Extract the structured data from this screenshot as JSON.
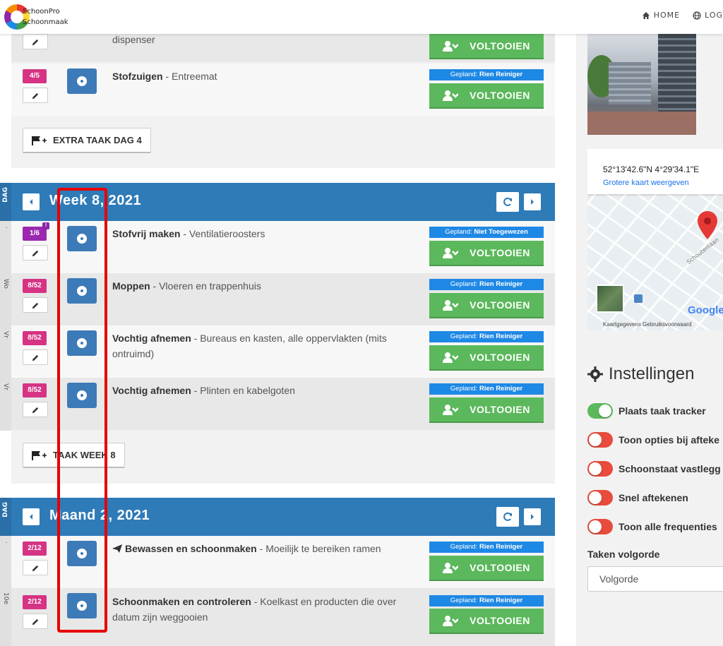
{
  "brand": {
    "line1": "SchoonPro",
    "line2": "Schoonmaak"
  },
  "nav": {
    "home": "HOME",
    "login": "LOG"
  },
  "colors": {
    "primary": "#2e7bb8",
    "success": "#5cb85c",
    "badge_pink": "#d63384",
    "badge_purple": "#9c27b0",
    "planned_blue": "#1e88e5",
    "toggle_off": "#e74c3c",
    "highlight": "#e60000"
  },
  "day4": {
    "rows": [
      {
        "task": "",
        "detail": "dispenser",
        "done": "VOLTOOIEN"
      },
      {
        "badge": "4/5",
        "task": "Stofzuigen",
        "detail": " - Entreemat",
        "planned_prefix": "Gepland: ",
        "planned_name": "Rien Reiniger",
        "done": "VOLTOOIEN"
      }
    ],
    "extra_button": "EXTRA TAAK DAG 4"
  },
  "week": {
    "side_label": "DAG",
    "title": "Week 8, 2021",
    "rows": [
      {
        "day": "·",
        "badge": "1/6",
        "badge_alert": "!",
        "task": "Stofvrij maken",
        "detail": " - Ventilatieroosters",
        "planned_prefix": "Gepland: ",
        "planned_name": "Niet Toegewezen",
        "done": "VOLTOOIEN"
      },
      {
        "day": "Wo",
        "badge": "8/52",
        "task": "Moppen",
        "detail": " - Vloeren en trappenhuis",
        "planned_prefix": "Gepland: ",
        "planned_name": "Rien Reiniger",
        "done": "VOLTOOIEN"
      },
      {
        "day": "Vr",
        "badge": "8/52",
        "task": "Vochtig afnemen",
        "detail": " - Bureaus en kasten, alle oppervlakten (mits ontruimd)",
        "planned_prefix": "Gepland: ",
        "planned_name": "Rien Reiniger",
        "done": "VOLTOOIEN"
      },
      {
        "day": "Vr",
        "badge": "8/52",
        "task": "Vochtig afnemen",
        "detail": " - Plinten en kabelgoten",
        "planned_prefix": "Gepland: ",
        "planned_name": "Rien Reiniger",
        "done": "VOLTOOIEN"
      }
    ],
    "extra_button": "TAAK WEEK 8"
  },
  "month": {
    "side_label": "DAG",
    "title": "Maand 2, 2021",
    "rows": [
      {
        "day": "·",
        "badge": "2/12",
        "task": "Bewassen en schoonmaken",
        "detail": " - Moeilijk te bereiken ramen",
        "planned_prefix": "Gepland: ",
        "planned_name": "Rien Reiniger",
        "done": "VOLTOOIEN"
      },
      {
        "day": "10e",
        "badge": "2/12",
        "task": "Schoonmaken en controleren",
        "detail": " - Koelkast en producten die over datum zijn weggooien",
        "planned_prefix": "Gepland: ",
        "planned_name": "Rien Reiniger",
        "done": "VOLTOOIEN"
      }
    ]
  },
  "map": {
    "coords": "52°13'42.6\"N 4°29'34.1\"E",
    "larger_link": "Grotere kaart weergeven",
    "footer": "Kaartgegevens  Gebruiksvoorwaard",
    "street": "Schoutenlaan",
    "google": "Google"
  },
  "settings": {
    "title": "Instellingen",
    "toggles": [
      {
        "label": "Plaats taak tracker",
        "state": "on"
      },
      {
        "label": "Toon opties bij afteke",
        "state": "off"
      },
      {
        "label": "Schoonstaat vastlegg",
        "state": "off"
      },
      {
        "label": "Snel aftekenen",
        "state": "off"
      },
      {
        "label": "Toon alle frequenties",
        "state": "off"
      }
    ],
    "order_label": "Taken volgorde",
    "order_value": "Volgorde"
  }
}
